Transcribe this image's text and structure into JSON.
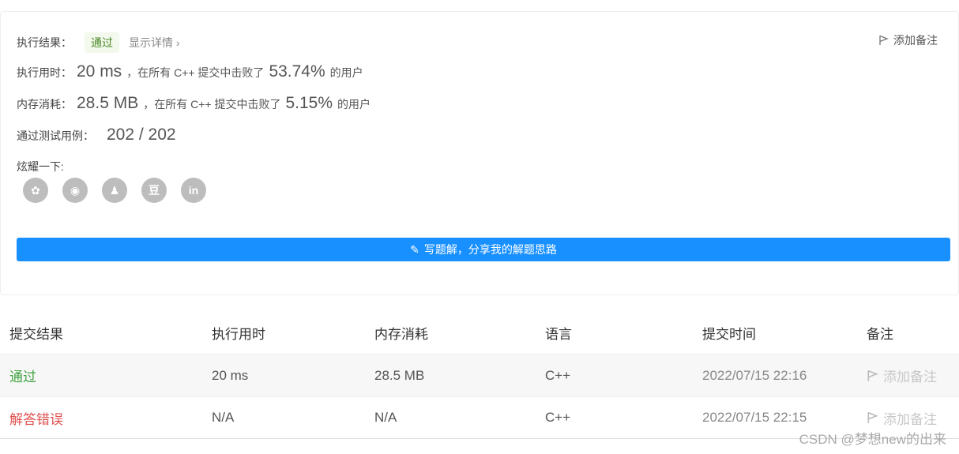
{
  "result": {
    "status_label": "执行结果：",
    "status_value": "通过",
    "detail_link": "显示详情 ›",
    "add_note": "添加备注",
    "time_label": "执行用时：",
    "time_value": "20 ms",
    "time_middle": "，在所有 C++ 提交中击败了",
    "time_percent": "53.74%",
    "time_suffix": "的用户",
    "mem_label": "内存消耗：",
    "mem_value": "28.5 MB",
    "mem_middle": "，在所有 C++ 提交中击败了",
    "mem_percent": "5.15%",
    "mem_suffix": "的用户",
    "tests_label": "通过测试用例：",
    "tests_value": "202 / 202",
    "show_label": "炫耀一下:",
    "share": [
      {
        "name": "wechat-icon",
        "glyph": "✿"
      },
      {
        "name": "weibo-icon",
        "glyph": "◉"
      },
      {
        "name": "qq-icon",
        "glyph": "♟"
      },
      {
        "name": "douban-icon",
        "glyph": "豆"
      },
      {
        "name": "linkedin-icon",
        "glyph": "in"
      }
    ],
    "write_button": "写题解，分享我的解题思路"
  },
  "table": {
    "headers": [
      "提交结果",
      "执行用时",
      "内存消耗",
      "语言",
      "提交时间",
      "备注"
    ],
    "rows": [
      {
        "status": "通过",
        "time": "20 ms",
        "memory": "28.5 MB",
        "lang": "C++",
        "submitted": "2022/07/15 22:16",
        "note": "添加备注"
      },
      {
        "status": "解答错误",
        "time": "N/A",
        "memory": "N/A",
        "lang": "C++",
        "submitted": "2022/07/15 22:15",
        "note": "添加备注"
      }
    ]
  },
  "watermark": "CSDN @梦想new的出来",
  "colors": {
    "primary": "#1890ff",
    "pass": "#3fa33f",
    "error": "#e05050"
  }
}
